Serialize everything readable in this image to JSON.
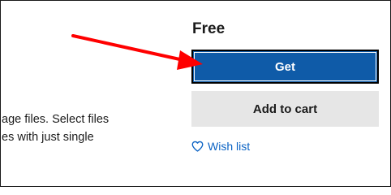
{
  "description": {
    "line1": "age files. Select files",
    "line2": "es with just single"
  },
  "purchase": {
    "price": "Free",
    "get_label": "Get",
    "add_to_cart_label": "Add to cart",
    "wish_list_label": "Wish list"
  },
  "icons": {
    "wish": "heart-icon",
    "annotation": "red-arrow"
  },
  "colors": {
    "get_button": "#0f5ba8",
    "cart_button": "#e6e6e6",
    "link": "#0b63c4",
    "annotation_arrow": "#ff0000"
  }
}
